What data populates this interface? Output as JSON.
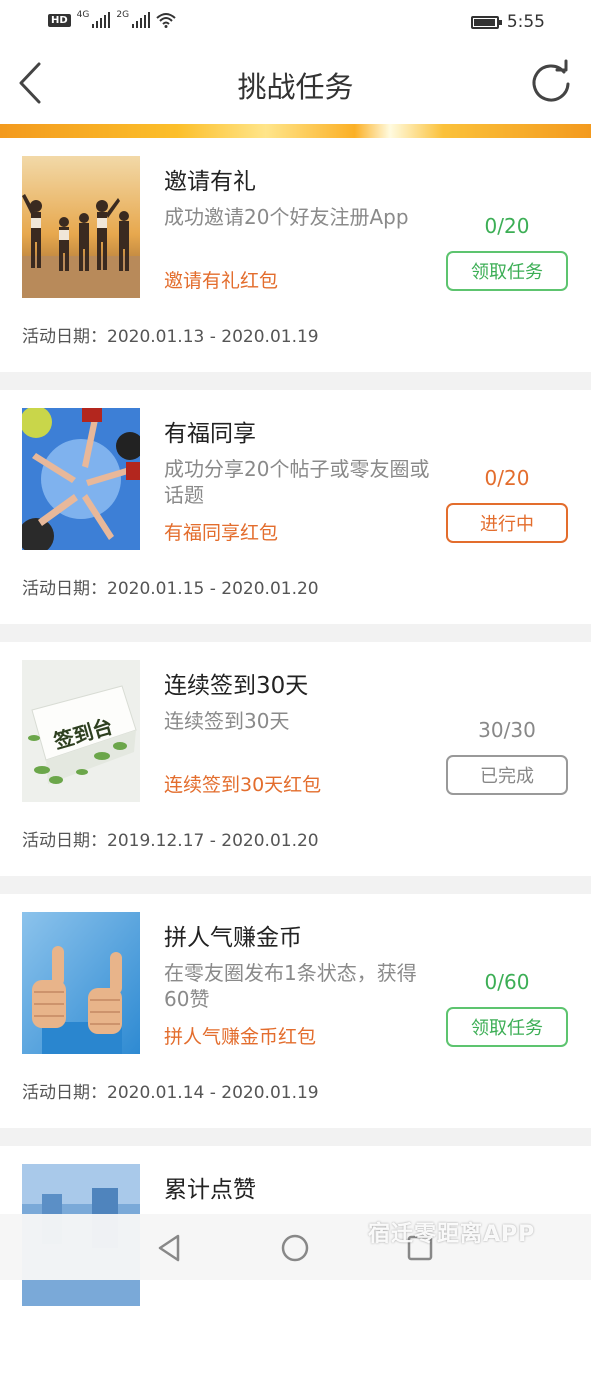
{
  "status": {
    "hd": "HD",
    "net1": "4G",
    "net2": "2G",
    "time": "5:55"
  },
  "nav": {
    "title": "挑战任务"
  },
  "tasks": [
    {
      "title": "邀请有礼",
      "desc": "成功邀请20个好友注册App",
      "reward": "邀请有礼红包",
      "progress": "0/20",
      "action": "领取任务",
      "date": "活动日期：2020.01.13 - 2020.01.19",
      "status_color": "#3cae55"
    },
    {
      "title": "有福同享",
      "desc": "成功分享20个帖子或零友圈或话题",
      "reward": "有福同享红包",
      "progress": "0/20",
      "action": "进行中",
      "date": "活动日期：2020.01.15 - 2020.01.20",
      "status_color": "#e36d2d"
    },
    {
      "title": "连续签到30天",
      "desc": "连续签到30天",
      "reward": "连续签到30天红包",
      "progress": "30/30",
      "action": "已完成",
      "date": "活动日期：2019.12.17 - 2020.01.20",
      "status_color": "#888888",
      "image_text": "签到台"
    },
    {
      "title": "拼人气赚金币",
      "desc": "在零友圈发布1条状态，获得60赞",
      "reward": "拼人气赚金币红包",
      "progress": "0/60",
      "action": "领取任务",
      "date": "活动日期：2020.01.14 - 2020.01.19",
      "status_color": "#3cae55"
    },
    {
      "title": "累计点赞"
    }
  ],
  "watermark": "宿迁零距离APP",
  "icons": [
    "back-arrow-icon",
    "refresh-icon",
    "back-triangle-icon",
    "home-circle-icon",
    "recents-square-icon"
  ]
}
